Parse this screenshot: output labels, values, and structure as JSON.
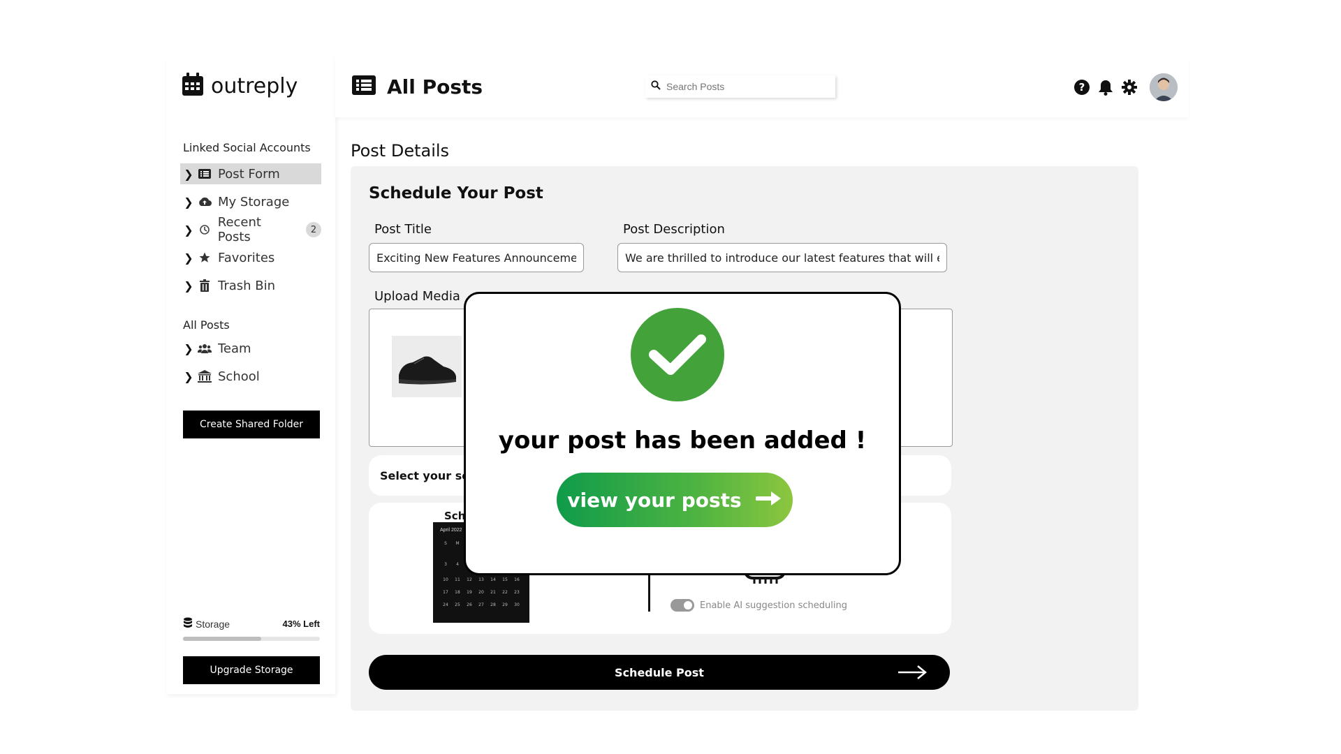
{
  "app": {
    "name": "outreply"
  },
  "header": {
    "title": "All Posts",
    "search_placeholder": "Search Posts",
    "icons": [
      "help-icon",
      "bell-icon",
      "gear-icon"
    ]
  },
  "sidebar": {
    "section1_label": "Linked Social Accounts",
    "items": [
      {
        "label": "Post Form",
        "icon": "list-icon",
        "active": true
      },
      {
        "label": "My Storage",
        "icon": "cloud-icon"
      },
      {
        "label": "Recent Posts",
        "icon": "history-icon",
        "badge": "2"
      },
      {
        "label": "Favorites",
        "icon": "star-icon"
      },
      {
        "label": "Trash Bin",
        "icon": "trash-icon"
      }
    ],
    "section2_label": "All Posts",
    "items2": [
      {
        "label": "Team",
        "icon": "team-icon"
      },
      {
        "label": "School",
        "icon": "school-icon"
      }
    ],
    "create_folder_label": "Create Shared Folder",
    "storage_label": "Storage",
    "storage_left": "43% Left",
    "storage_fill": 0.57,
    "upgrade_label": "Upgrade Storage"
  },
  "main": {
    "page_title": "Post Details",
    "panel_title": "Schedule Your Post",
    "post_title_label": "Post Title",
    "post_title_value": "Exciting New Features Announcement",
    "post_desc_label": "Post Description",
    "post_desc_value": "We are thrilled to introduce our latest features that will enhance",
    "upload_label": "Upload Media",
    "select_social_partial": "Select your soc",
    "schedule_partial": "Sch",
    "calendar_month": "April 2022",
    "ai_toggle_label": "Enable AI suggestion scheduling",
    "schedule_button": "Schedule Post"
  },
  "modal": {
    "message": "your post has been added !",
    "button_label": "view your posts"
  },
  "colors": {
    "success_green": "#43a33a",
    "gradient_start": "#0f9b4a",
    "gradient_end": "#8cc63f",
    "active_nav": "#d9d9d9"
  }
}
